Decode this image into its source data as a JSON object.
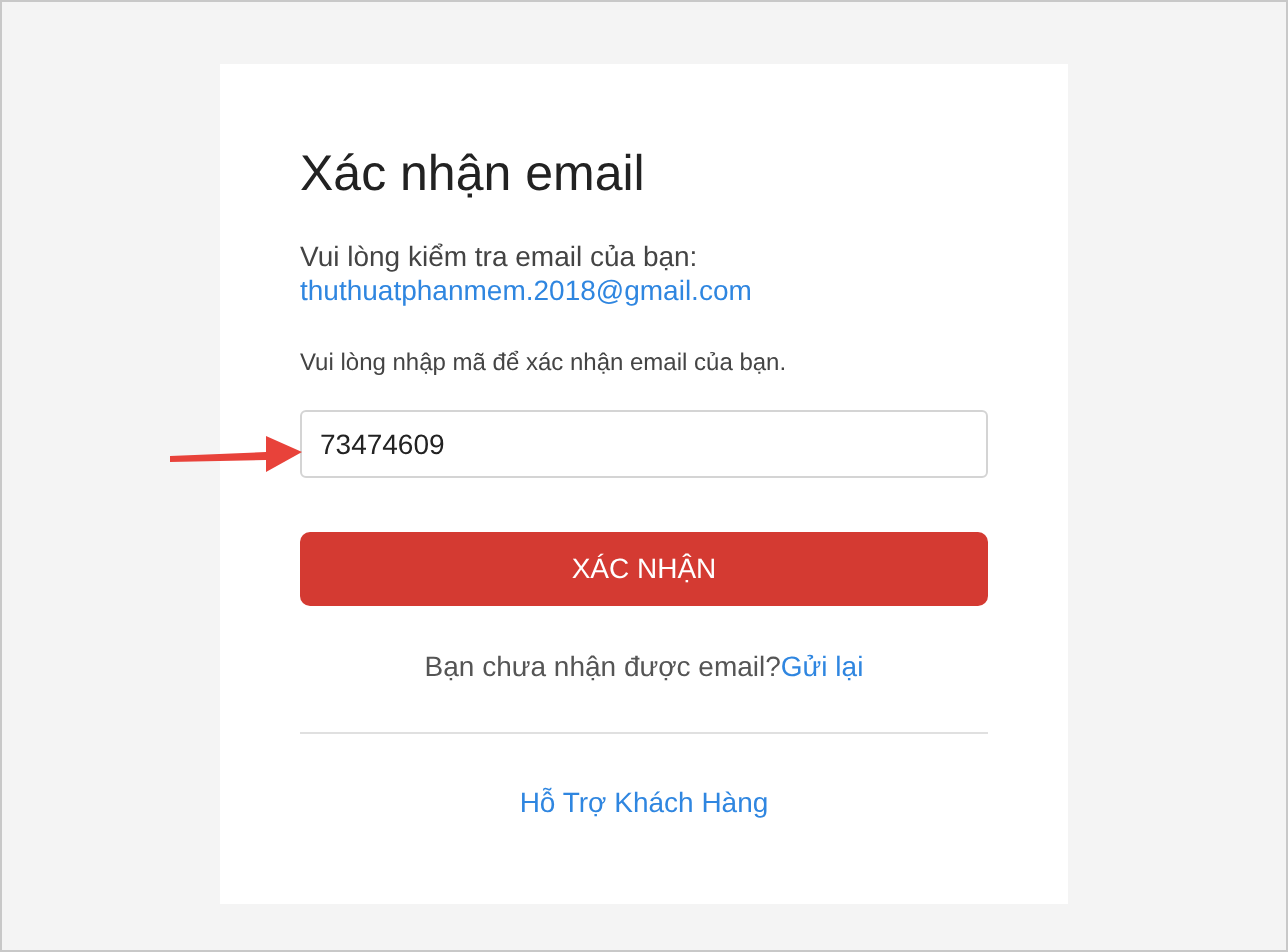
{
  "title": "Xác nhận email",
  "intro": "Vui lòng kiểm tra email của bạn:",
  "email": "thuthuatphanmem.2018@gmail.com",
  "prompt": "Vui lòng nhập mã để xác nhận email của bạn.",
  "code_field": {
    "value": "73474609"
  },
  "confirm_button": "XÁC NHẬN",
  "resend": {
    "text": "Bạn chưa nhận được email?",
    "link": "Gửi lại"
  },
  "support_link": "Hỗ Trợ Khách Hàng"
}
